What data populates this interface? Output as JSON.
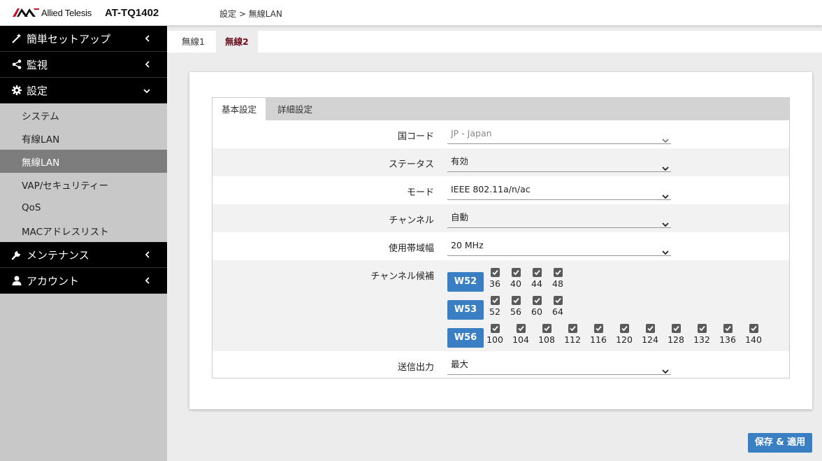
{
  "header": {
    "logo_text": "Allied Telesis",
    "model": "AT-TQ1402",
    "breadcrumb": "設定 > 無線LAN"
  },
  "sidebar": {
    "groups": [
      {
        "label": "簡単セットアップ",
        "icon": "magic-wand-icon",
        "expanded": false
      },
      {
        "label": "監視",
        "icon": "share-icon",
        "expanded": false
      },
      {
        "label": "設定",
        "icon": "gear-icon",
        "expanded": true
      },
      {
        "label": "メンテナンス",
        "icon": "wrench-icon",
        "expanded": false
      },
      {
        "label": "アカウント",
        "icon": "user-icon",
        "expanded": false
      }
    ],
    "settings_items": [
      "システム",
      "有線LAN",
      "無線LAN",
      "VAP/セキュリティー",
      "QoS",
      "MACアドレスリスト"
    ],
    "active_item": "無線LAN"
  },
  "top_tabs": [
    "無線1",
    "無線2"
  ],
  "top_tabs_active": "無線2",
  "sub_tabs": [
    "基本設定",
    "詳細設定"
  ],
  "sub_tabs_active": "基本設定",
  "form": {
    "country": {
      "label": "国コード",
      "value": "JP - Japan"
    },
    "status": {
      "label": "ステータス",
      "value": "有効"
    },
    "mode": {
      "label": "モード",
      "value": "IEEE 802.11a/n/ac"
    },
    "channel": {
      "label": "チャンネル",
      "value": "自動"
    },
    "bandwidth": {
      "label": "使用帯域幅",
      "value": "20 MHz"
    },
    "channel_candidates": {
      "label": "チャンネル候補",
      "bands": [
        {
          "name": "W52",
          "channels": [
            "36",
            "40",
            "44",
            "48"
          ]
        },
        {
          "name": "W53",
          "channels": [
            "52",
            "56",
            "60",
            "64"
          ]
        },
        {
          "name": "W56",
          "channels": [
            "100",
            "104",
            "108",
            "112",
            "116",
            "120",
            "124",
            "128",
            "132",
            "136",
            "140"
          ]
        }
      ]
    },
    "tx_power": {
      "label": "送信出力",
      "value": "最大"
    }
  },
  "save_button": "保存 & 適用",
  "colors": {
    "accent": "#3a7fc4",
    "active_tab": "#6b0e1e",
    "sidebar_head": "#000000",
    "sidebar_active": "#7d7d7d"
  }
}
